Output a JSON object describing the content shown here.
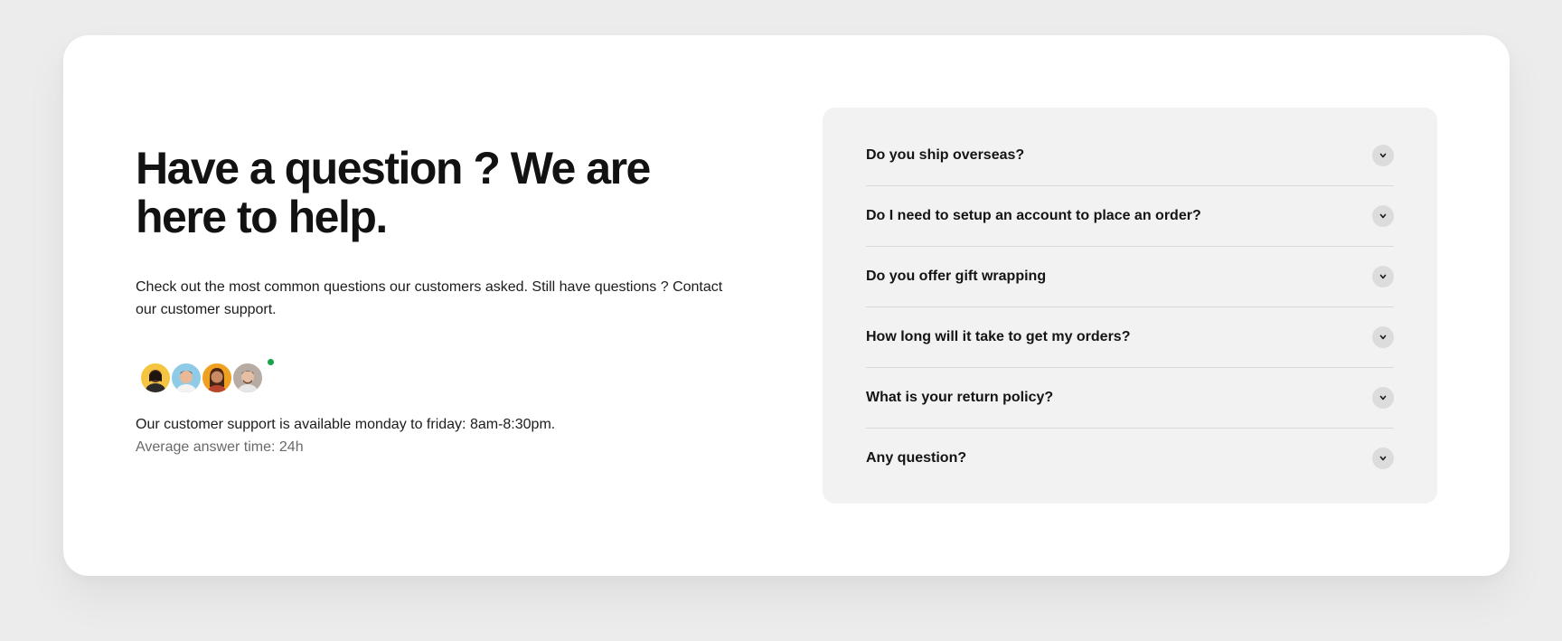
{
  "hero": {
    "title": "Have a question ? We are here to help.",
    "intro": "Check out the most common questions our customers asked. Still have questions ? Contact our customer support."
  },
  "support": {
    "avatars": [
      {
        "name": "support-avatar-1",
        "bg": "#f5c542"
      },
      {
        "name": "support-avatar-2",
        "bg": "#8fcbe6"
      },
      {
        "name": "support-avatar-3",
        "bg": "#f0a020"
      },
      {
        "name": "support-avatar-4",
        "bg": "#b7aca3"
      }
    ],
    "online_color": "#18a34a",
    "availability": "Our customer support is available monday to friday: 8am-8:30pm.",
    "average_answer_time": "Average answer time: 24h"
  },
  "faq": {
    "items": [
      {
        "question": "Do you ship overseas?"
      },
      {
        "question": "Do I need to setup an account to place an order?"
      },
      {
        "question": "Do you offer gift wrapping"
      },
      {
        "question": "How long will it take to get my orders?"
      },
      {
        "question": "What is your return policy?"
      },
      {
        "question": "Any question?"
      }
    ],
    "chevron_icon": "chevron-down-icon"
  }
}
